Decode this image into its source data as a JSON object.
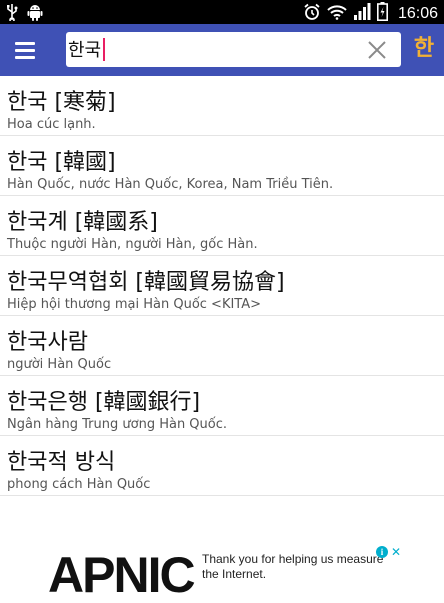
{
  "status_bar": {
    "time": "16:06",
    "left_icons": [
      "usb-icon",
      "android-icon"
    ],
    "right_icons": [
      "alarm-icon",
      "wifi-icon",
      "signal-icon",
      "battery-icon"
    ]
  },
  "app_bar": {
    "color": "#3f51b5",
    "menu_icon": "hamburger-menu-icon",
    "search": {
      "value": "한국",
      "placeholder": ""
    },
    "clear_icon": "clear-x-icon",
    "lang_toggle": "한",
    "lang_toggle_color": "#f2b134"
  },
  "results": [
    {
      "headword": "한국 [寒菊]",
      "meaning": "Hoa cúc lạnh."
    },
    {
      "headword": "한국 [韓國]",
      "meaning": "Hàn Quốc, nước Hàn Quốc, Korea, Nam Triều Tiên."
    },
    {
      "headword": "한국계 [韓國系]",
      "meaning": "Thuộc người Hàn, người Hàn, gốc Hàn."
    },
    {
      "headword": "한국무역협회 [韓國貿易協會]",
      "meaning": "Hiệp hội thương mại Hàn Quốc <KITA>"
    },
    {
      "headword": "한국사람",
      "meaning": "người Hàn Quốc"
    },
    {
      "headword": "한국은행 [韓國銀行]",
      "meaning": "Ngân hàng Trung ương Hàn Quốc."
    },
    {
      "headword": "한국적 방식",
      "meaning": "phong cách Hàn Quốc"
    }
  ],
  "ad": {
    "logo_text": "APNIC",
    "message": "Thank you for helping us measure the Internet.",
    "info_icon": "adchoices-info-icon",
    "close_icon": "ad-close-icon"
  }
}
